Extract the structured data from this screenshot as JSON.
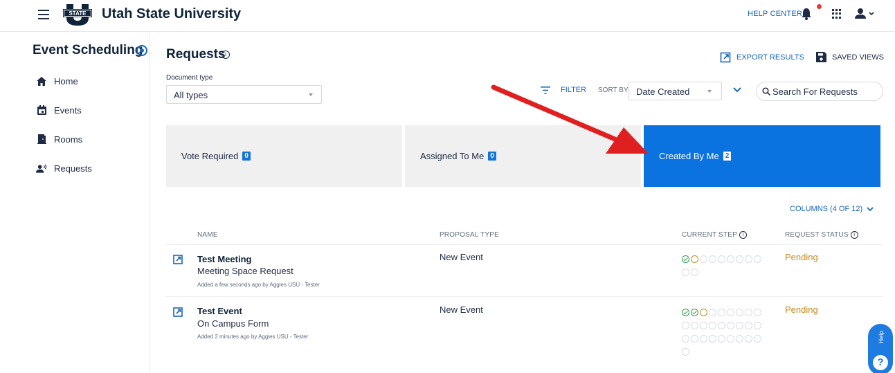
{
  "header": {
    "app_title": "Utah State University",
    "logo_text": "STATE",
    "help_center": "HELP CENTER"
  },
  "sidebar": {
    "title": "Event Scheduling",
    "items": [
      {
        "label": "Home",
        "icon": "home-icon"
      },
      {
        "label": "Events",
        "icon": "calendar-icon"
      },
      {
        "label": "Rooms",
        "icon": "door-icon"
      },
      {
        "label": "Requests",
        "icon": "people-icon"
      }
    ]
  },
  "main": {
    "title": "Requests",
    "export_label": "EXPORT RESULTS",
    "saved_views_label": "SAVED VIEWS",
    "document_type_label": "Document type",
    "document_type_value": "All types",
    "filter_label": "FILTER",
    "sort_by_label": "SORT BY",
    "sort_value": "Date Created",
    "search_placeholder": "Search For Requests",
    "columns_label": "COLUMNS (4 OF 12)"
  },
  "tiles": [
    {
      "label": "Vote Required",
      "count": "0",
      "active": false
    },
    {
      "label": "Assigned To Me",
      "count": "0",
      "active": false
    },
    {
      "label": "Created By Me",
      "count": "2",
      "active": true
    }
  ],
  "table": {
    "headers": {
      "name": "NAME",
      "proposal_type": "PROPOSAL TYPE",
      "current_step": "CURRENT STEP",
      "request_status": "REQUEST STATUS"
    },
    "rows": [
      {
        "name": "Test Meeting",
        "form": "Meeting Space Request",
        "meta": "Added a few seconds ago by Aggies USU - Tester",
        "proposal_type": "New Event",
        "status": "Pending",
        "steps_done": 1,
        "steps_total": 11
      },
      {
        "name": "Test Event",
        "form": "On Campus Form",
        "meta": "Added 2 minutes ago by Aggies USU - Tester",
        "proposal_type": "New Event",
        "status": "Pending",
        "steps_done": 2,
        "steps_total": 28
      }
    ]
  },
  "help_widget": {
    "label": "Help",
    "symbol": "?"
  },
  "colors": {
    "accent": "#0b73e0",
    "pending": "#c48a1a",
    "done": "#2e9a4a",
    "annotation_arrow": "#e02020"
  }
}
